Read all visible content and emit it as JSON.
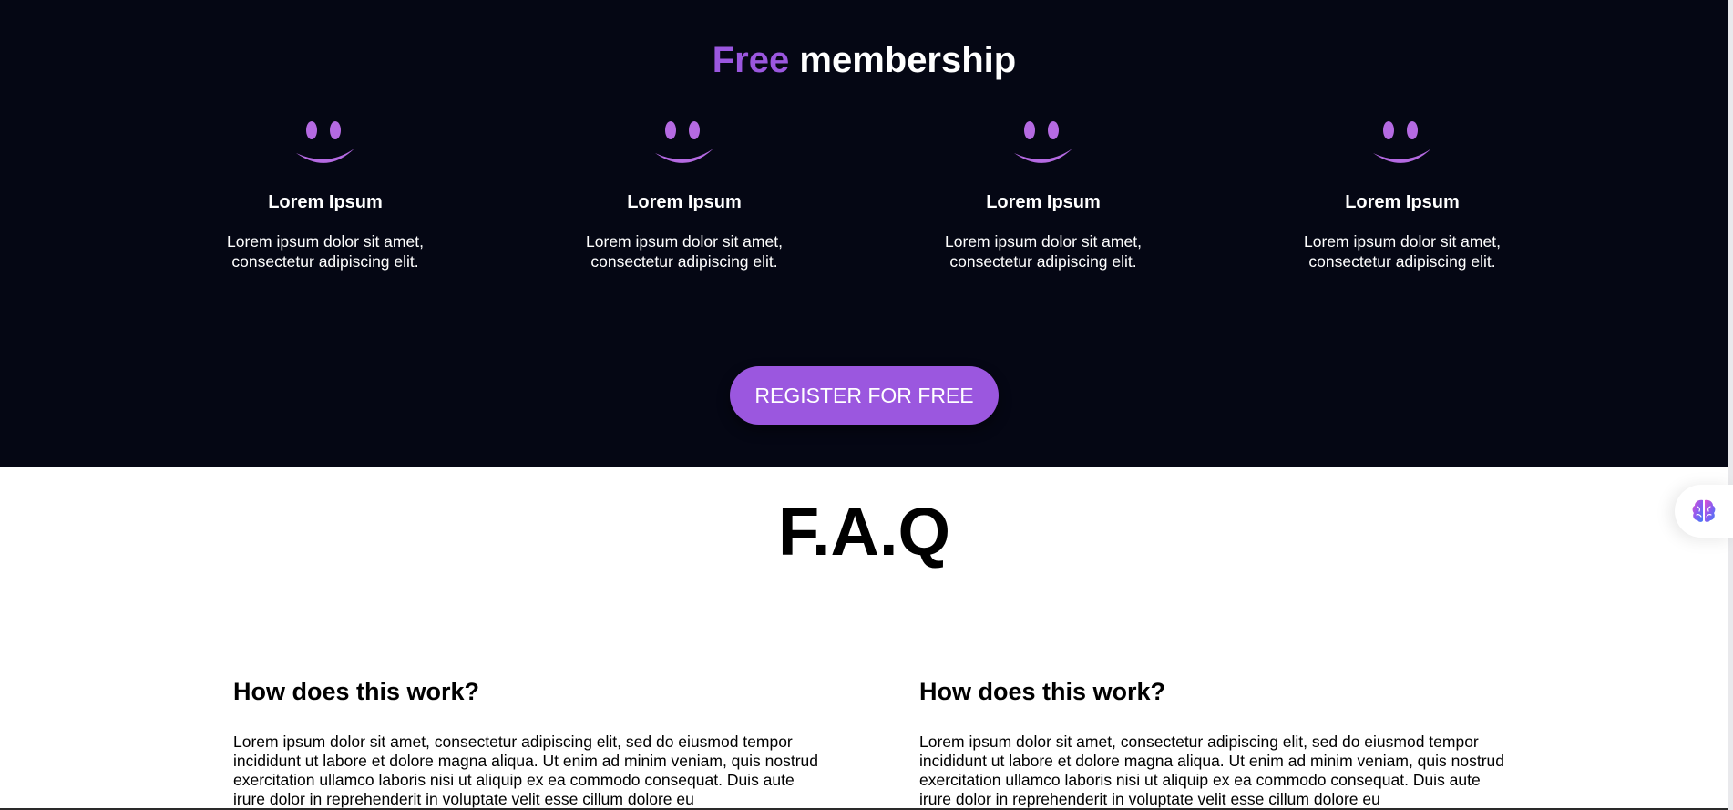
{
  "membership": {
    "title_accent": "Free",
    "title_rest": "membership",
    "features": [
      {
        "icon": "smiley-icon",
        "title": "Lorem Ipsum",
        "text": "Lorem ipsum dolor sit amet, consectetur adipiscing elit."
      },
      {
        "icon": "smiley-icon",
        "title": "Lorem Ipsum",
        "text": "Lorem ipsum dolor sit amet, consectetur adipiscing elit."
      },
      {
        "icon": "smiley-icon",
        "title": "Lorem Ipsum",
        "text": "Lorem ipsum dolor sit amet, consectetur adipiscing elit."
      },
      {
        "icon": "smiley-icon",
        "title": "Lorem Ipsum",
        "text": "Lorem ipsum dolor sit amet, consectetur adipiscing elit."
      }
    ],
    "register_label": "REGISTER FOR FREE"
  },
  "faq": {
    "title": "F.A.Q",
    "items": [
      {
        "question": "How does this work?",
        "answer": "Lorem ipsum dolor sit amet, consectetur adipiscing elit, sed do eiusmod tempor incididunt ut labore et dolore magna aliqua. Ut enim ad minim veniam, quis nostrud exercitation ullamco laboris nisi ut aliquip ex ea commodo consequat. Duis aute irure dolor in reprehenderit in voluptate velit esse cillum dolore eu"
      },
      {
        "question": "How does this work?",
        "answer": "Lorem ipsum dolor sit amet, consectetur adipiscing elit, sed do eiusmod tempor incididunt ut labore et dolore magna aliqua. Ut enim ad minim veniam, quis nostrud exercitation ullamco laboris nisi ut aliquip ex ea commodo consequat. Duis aute irure dolor in reprehenderit in voluptate velit esse cillum dolore eu"
      }
    ]
  },
  "widget": {
    "icon": "brain-icon"
  },
  "colors": {
    "accent": "#9b57df",
    "dark_background": "#050714",
    "light_background": "#ffffff"
  }
}
